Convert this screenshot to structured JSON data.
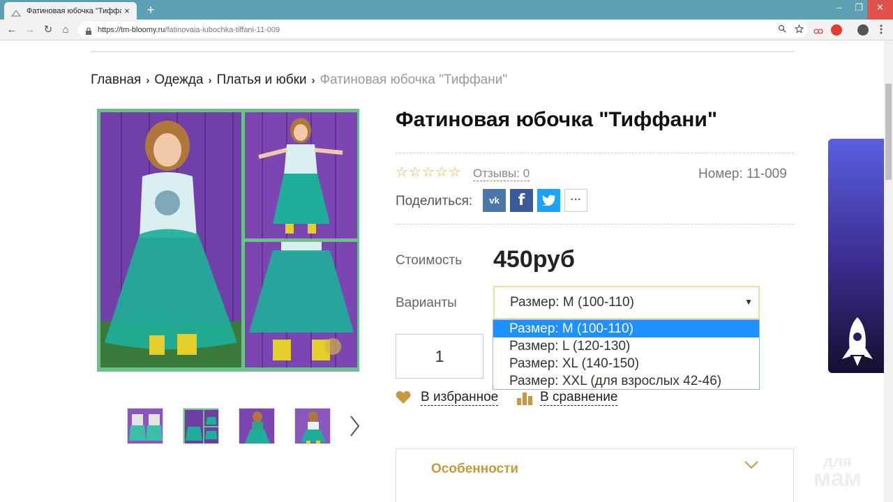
{
  "browser": {
    "tab_title": "Фатиновая юбочка \"Тиффани\"",
    "tab_close": "×",
    "new_tab": "+",
    "url_host": "https://tm-bloomy.ru",
    "url_path": "/fatinovaia-iubochka-tiffani-11-009",
    "nav": {
      "back": "←",
      "forward": "→",
      "reload": "↻",
      "home": "⌂"
    },
    "window": {
      "minimize": "–",
      "maximize": "❐",
      "close": "✕"
    }
  },
  "breadcrumb": {
    "items": [
      "Главная",
      "Одежда",
      "Платья и юбки"
    ],
    "current": "Фатиновая юбочка \"Тиффани\"",
    "separator": "›"
  },
  "product": {
    "title": "Фатиновая юбочка \"Тиффани\"",
    "rating_stars": 5,
    "rating_value": 0,
    "star_glyph": "☆",
    "reviews_link": "Отзывы: 0",
    "sku": "Номер:  11-009",
    "share_label": "Поделиться:",
    "share": {
      "vk": "vk",
      "facebook": "f",
      "twitter": "t",
      "more": "···"
    },
    "price_label": "Стоимость",
    "price": "450руб",
    "variants_label": "Варианты",
    "variant_selected": "Размер: M (100-110)",
    "variant_options": [
      "Размер: M (100-110)",
      "Размер: L (120-130)",
      "Размер: XL (140-150)",
      "Размер: XXL (для взрослых 42-46)"
    ],
    "quantity": "1",
    "favorite_link": "В избранное",
    "compare_link": "В сравнение",
    "features_title": "Особенности"
  },
  "watermark": {
    "small": "для",
    "big": "мам"
  },
  "colors": {
    "accent_gold": "#c8983e",
    "star": "#e3b53a",
    "dropdown_selected": "#1e90ff",
    "tabbar": "#5ea0b4",
    "vk": "#4a76a8",
    "facebook": "#3b5998",
    "twitter": "#1da1f2"
  },
  "icons": {
    "favorite": "heart-icon",
    "compare": "bar-chart-icon",
    "features_toggle": "chevron-down-icon",
    "gallery_next": "chevron-right-icon"
  }
}
